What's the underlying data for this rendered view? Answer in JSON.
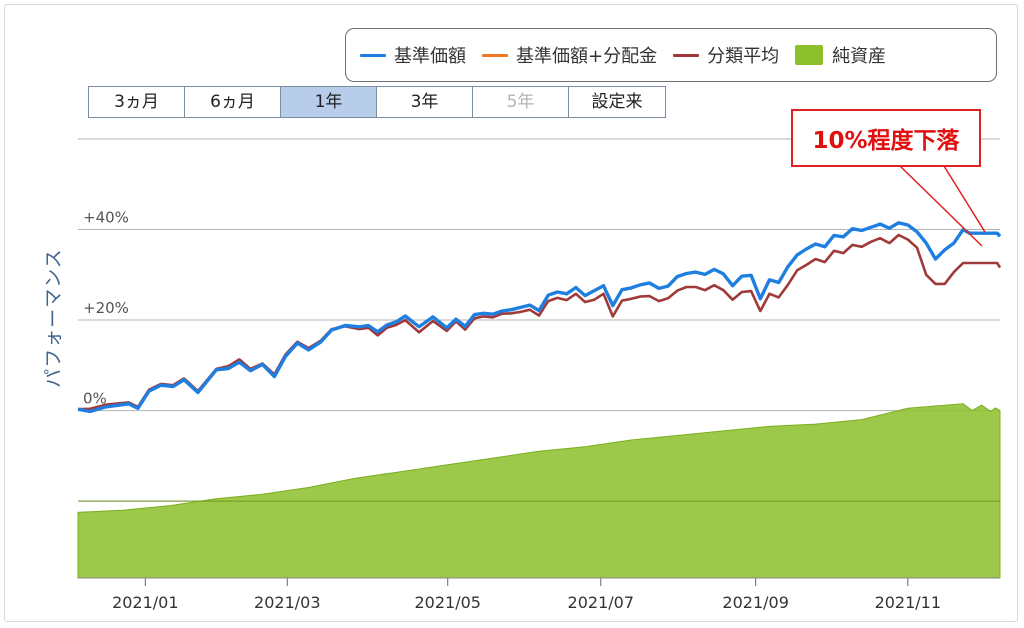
{
  "chart_data": {
    "type": "line",
    "title": "",
    "ylabel": "パフォーマンス",
    "xlabel": "",
    "ylim": [
      -37,
      62
    ],
    "y_ticks": [
      {
        "value": 40,
        "label": "+40%"
      },
      {
        "value": 20,
        "label": "+20%"
      },
      {
        "value": 0,
        "label": "0%"
      },
      {
        "value": -20,
        "label": ""
      },
      {
        "value": 60,
        "label": ""
      }
    ],
    "x_ticks": [
      "2021/01",
      "2021/03",
      "2021/05",
      "2021/07",
      "2021/09",
      "2021/11"
    ],
    "x_range": [
      "2020-12",
      "2021-12"
    ],
    "legend_position": "top-right",
    "range_tabs": [
      {
        "label": "3ヵ月",
        "state": "normal"
      },
      {
        "label": "6ヵ月",
        "state": "normal"
      },
      {
        "label": "1年",
        "state": "active"
      },
      {
        "label": "3年",
        "state": "normal"
      },
      {
        "label": "5年",
        "state": "disabled"
      },
      {
        "label": "設定来",
        "state": "normal"
      }
    ],
    "annotation": {
      "text": "10%程度下落",
      "color": "#e01010"
    },
    "series": [
      {
        "name": "基準価額",
        "color": "#1e7fe0",
        "kind": "line",
        "x": [
          0.0,
          0.013,
          0.03,
          0.055,
          0.065,
          0.077,
          0.09,
          0.103,
          0.115,
          0.13,
          0.15,
          0.163,
          0.175,
          0.187,
          0.2,
          0.213,
          0.225,
          0.238,
          0.25,
          0.263,
          0.275,
          0.29,
          0.305,
          0.315,
          0.325,
          0.335,
          0.345,
          0.355,
          0.37,
          0.385,
          0.4,
          0.41,
          0.42,
          0.43,
          0.44,
          0.45,
          0.46,
          0.47,
          0.48,
          0.49,
          0.5,
          0.51,
          0.52,
          0.53,
          0.54,
          0.55,
          0.56,
          0.57,
          0.58,
          0.59,
          0.6,
          0.61,
          0.62,
          0.63,
          0.64,
          0.65,
          0.66,
          0.67,
          0.68,
          0.69,
          0.7,
          0.71,
          0.72,
          0.73,
          0.74,
          0.75,
          0.76,
          0.77,
          0.78,
          0.79,
          0.8,
          0.81,
          0.82,
          0.83,
          0.84,
          0.85,
          0.86,
          0.87,
          0.88,
          0.89,
          0.9,
          0.91,
          0.92,
          0.93,
          0.94,
          0.95,
          0.96,
          0.967,
          0.975,
          0.983,
          0.99,
          0.997,
          1.0
        ],
        "values": [
          0.3,
          -0.2,
          0.8,
          1.5,
          0.5,
          4.3,
          5.6,
          5.3,
          6.8,
          4.0,
          9.0,
          9.3,
          10.7,
          8.8,
          10.2,
          7.5,
          12.0,
          14.9,
          13.4,
          15.1,
          17.8,
          18.8,
          18.5,
          18.8,
          17.4,
          18.9,
          19.6,
          20.9,
          18.5,
          20.7,
          18.3,
          20.2,
          18.6,
          21.2,
          21.5,
          21.3,
          22.0,
          22.3,
          22.8,
          23.3,
          22.1,
          25.5,
          26.2,
          25.8,
          27.2,
          25.4,
          26.5,
          27.6,
          23.2,
          26.7,
          27.1,
          27.8,
          28.2,
          27.0,
          27.5,
          29.6,
          30.3,
          30.6,
          30.1,
          31.2,
          30.2,
          27.6,
          29.7,
          29.9,
          24.7,
          28.9,
          28.3,
          31.8,
          34.4,
          35.7,
          36.8,
          36.2,
          38.7,
          38.4,
          40.2,
          39.8,
          40.5,
          41.2,
          40.3,
          41.5,
          41.0,
          39.5,
          37.0,
          33.5,
          35.5,
          37.0,
          40.0,
          39.2,
          39.2,
          39.2,
          39.2,
          39.2,
          38.5
        ]
      },
      {
        "name": "基準価額+分配金",
        "color": "#f07820",
        "kind": "line",
        "x": [],
        "values": []
      },
      {
        "name": "分類平均",
        "color": "#a03a3a",
        "kind": "line",
        "x": [
          0.0,
          0.013,
          0.03,
          0.055,
          0.065,
          0.077,
          0.09,
          0.103,
          0.115,
          0.13,
          0.15,
          0.163,
          0.175,
          0.187,
          0.2,
          0.213,
          0.225,
          0.238,
          0.25,
          0.263,
          0.275,
          0.29,
          0.305,
          0.315,
          0.325,
          0.335,
          0.345,
          0.355,
          0.37,
          0.385,
          0.4,
          0.41,
          0.42,
          0.43,
          0.44,
          0.45,
          0.46,
          0.47,
          0.48,
          0.49,
          0.5,
          0.51,
          0.52,
          0.53,
          0.54,
          0.55,
          0.56,
          0.57,
          0.58,
          0.59,
          0.6,
          0.61,
          0.62,
          0.63,
          0.64,
          0.65,
          0.66,
          0.67,
          0.68,
          0.69,
          0.7,
          0.71,
          0.72,
          0.73,
          0.74,
          0.75,
          0.76,
          0.77,
          0.78,
          0.79,
          0.8,
          0.81,
          0.82,
          0.83,
          0.84,
          0.85,
          0.86,
          0.87,
          0.88,
          0.89,
          0.9,
          0.91,
          0.92,
          0.93,
          0.94,
          0.95,
          0.96,
          0.967,
          0.975,
          0.983,
          0.99,
          0.997,
          1.0
        ],
        "values": [
          0.3,
          0.4,
          1.3,
          1.8,
          0.8,
          4.6,
          5.9,
          5.6,
          7.1,
          4.3,
          9.2,
          9.8,
          11.3,
          9.2,
          10.4,
          8.0,
          12.4,
          15.2,
          13.8,
          15.4,
          18.0,
          18.6,
          18.0,
          18.3,
          16.6,
          18.3,
          18.9,
          20.0,
          17.3,
          19.8,
          17.6,
          19.7,
          17.9,
          20.4,
          20.8,
          20.6,
          21.4,
          21.5,
          21.8,
          22.3,
          21.0,
          24.2,
          24.9,
          24.4,
          25.8,
          24.0,
          24.5,
          25.8,
          20.8,
          24.3,
          24.7,
          25.2,
          25.3,
          24.2,
          24.8,
          26.5,
          27.3,
          27.3,
          26.6,
          27.7,
          26.6,
          24.5,
          26.2,
          26.4,
          22.0,
          25.8,
          25.0,
          27.8,
          31.0,
          32.2,
          33.5,
          32.8,
          35.3,
          34.8,
          36.6,
          36.2,
          37.3,
          38.1,
          37.0,
          38.8,
          37.8,
          36.0,
          30.0,
          28.0,
          28.0,
          30.6,
          32.6,
          32.6,
          32.6,
          32.6,
          32.6,
          32.6,
          31.6
        ]
      },
      {
        "name": "純資産",
        "color": "#8cbf2a",
        "kind": "area",
        "x": [
          0.0,
          0.05,
          0.1,
          0.15,
          0.2,
          0.25,
          0.3,
          0.35,
          0.4,
          0.45,
          0.5,
          0.55,
          0.6,
          0.65,
          0.7,
          0.75,
          0.8,
          0.85,
          0.9,
          0.93,
          0.96,
          0.97,
          0.98,
          0.99,
          0.995,
          1.0
        ],
        "values": [
          -22.5,
          -22.0,
          -21.0,
          -19.5,
          -18.5,
          -17.0,
          -15.0,
          -13.5,
          -12.0,
          -10.5,
          -9.0,
          -8.0,
          -6.5,
          -5.5,
          -4.5,
          -3.5,
          -3.0,
          -2.0,
          0.5,
          1.0,
          1.5,
          0.0,
          1.2,
          -0.2,
          0.6,
          0.0
        ]
      }
    ]
  }
}
